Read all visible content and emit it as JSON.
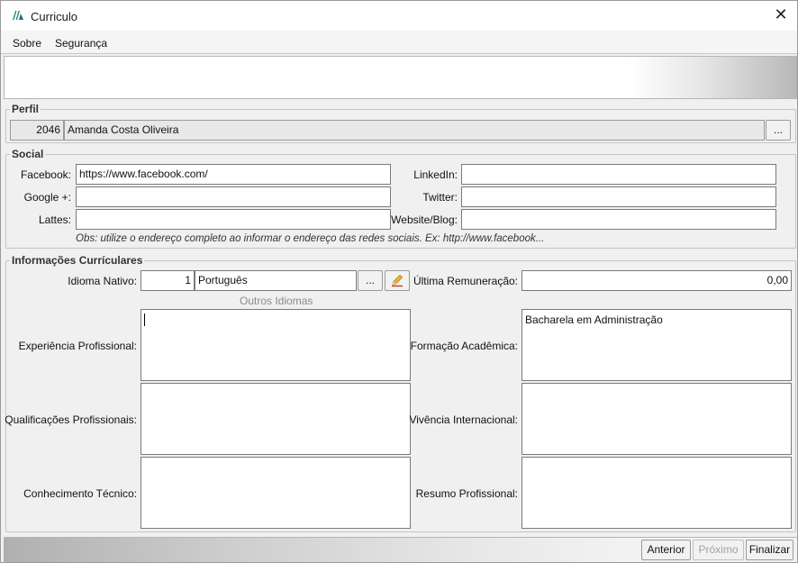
{
  "window": {
    "title": "Curriculo"
  },
  "menu": {
    "items": [
      "Sobre",
      "Segurança"
    ]
  },
  "perfil": {
    "legend": "Perfil",
    "code": "2046",
    "name": "Amanda Costa Oliveira",
    "lookup_label": "..."
  },
  "social": {
    "legend": "Social",
    "facebook_label": "Facebook:",
    "facebook_value": "https://www.facebook.com/",
    "google_label": "Google +:",
    "google_value": "",
    "lattes_label": "Lattes:",
    "lattes_value": "",
    "linkedin_label": "LinkedIn:",
    "linkedin_value": "",
    "twitter_label": "Twitter:",
    "twitter_value": "",
    "website_label": "Website/Blog:",
    "website_value": "",
    "note": "Obs: utilize o endereço completo ao informar o endereço das redes sociais. Ex: http://www.facebook..."
  },
  "info": {
    "legend": "Informações Currículares",
    "idioma_label": "Idioma Nativo:",
    "idioma_code": "1",
    "idioma_name": "Português",
    "idioma_lookup": "...",
    "remuneracao_label": "Última Remuneração:",
    "remuneracao_value": "0,00",
    "outros_idiomas": "Outros Idiomas",
    "experiencia_label": "Experiência Profissional:",
    "experiencia_value": "",
    "qualificacoes_label": "Qualificações Profissionais:",
    "qualificacoes_value": "",
    "conhecimento_label": "Conhecimento Técnico:",
    "conhecimento_value": "",
    "formacao_label": "Formação Acadêmica:",
    "formacao_value": "Bacharela em Administração",
    "vivencia_label": "Vivência Internacional:",
    "vivencia_value": "",
    "resumo_label": "Resumo Profissional:",
    "resumo_value": ""
  },
  "footer": {
    "prev": "Anterior",
    "next": "Próximo",
    "finish": "Finalizar"
  },
  "icons": {
    "app": "app-logo-icon",
    "close": "close-icon",
    "edit": "pencil-edit-icon"
  }
}
